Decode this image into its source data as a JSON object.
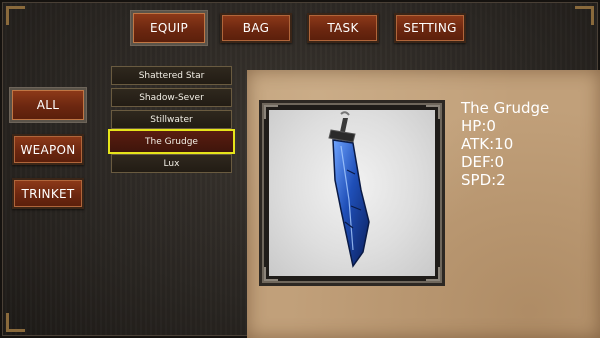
{
  "top_tabs": [
    "EQUIP",
    "BAG",
    "TASK",
    "SETTING"
  ],
  "filters": [
    "ALL",
    "WEAPON",
    "TRINKET"
  ],
  "items": [
    "Shattered Star",
    "Shadow-Sever",
    "Stillwater",
    "The Grudge",
    "Lux"
  ],
  "selected_item": "The Grudge",
  "detail": {
    "name": "The Grudge",
    "hp": "HP:0",
    "atk": "ATK:10",
    "def": "DEF:0",
    "spd": "SPD:2"
  },
  "colors": {
    "button": "#7a2d13",
    "selection_outline": "#e6e41a",
    "parchment": "#c1a07a"
  },
  "icons": {
    "preview": "broken-blue-sword-icon"
  }
}
